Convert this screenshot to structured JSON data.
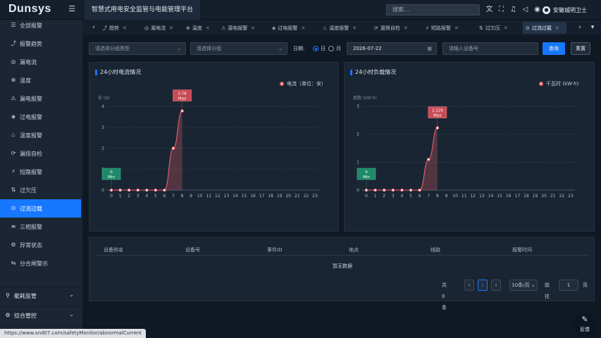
{
  "header": {
    "logo": "Dunsys",
    "app_title": "智慧式用电安全监管与电能管理平台",
    "search_placeholder": "搜索...",
    "user_name": "安徽城明卫士",
    "icons": [
      "translate-icon",
      "fullscreen-icon",
      "bell-icon",
      "volume-icon",
      "globe-icon"
    ]
  },
  "sidebar": {
    "items": [
      {
        "label": "全部报警",
        "icon": "list-icon"
      },
      {
        "label": "报警趋势",
        "icon": "trend-icon"
      },
      {
        "label": "漏电流",
        "icon": "leak-icon"
      },
      {
        "label": "温度",
        "icon": "thermometer-icon"
      },
      {
        "label": "漏电报警",
        "icon": "warning-icon"
      },
      {
        "label": "过电报警",
        "icon": "shield-icon"
      },
      {
        "label": "温度报警",
        "icon": "thermo-alarm-icon"
      },
      {
        "label": "漏保自检",
        "icon": "selfcheck-icon"
      },
      {
        "label": "短路报警",
        "icon": "shortcircuit-icon"
      },
      {
        "label": "过欠压",
        "icon": "voltage-icon"
      },
      {
        "label": "过流过载",
        "icon": "overload-icon"
      },
      {
        "label": "三相报警",
        "icon": "threephase-icon"
      },
      {
        "label": "异常状态",
        "icon": "abnormal-icon"
      },
      {
        "label": "分合闸警示",
        "icon": "switch-icon"
      }
    ],
    "active_index": 10,
    "groups": [
      {
        "label": "能耗监管"
      },
      {
        "label": "综合管控"
      }
    ]
  },
  "status_url": "https://www.snd07.com/safetyMonitor/abnormalCurrent",
  "tabs": [
    {
      "label": "趋势"
    },
    {
      "label": "漏电流"
    },
    {
      "label": "温度"
    },
    {
      "label": "漏电报警"
    },
    {
      "label": "过电报警"
    },
    {
      "label": "温度报警"
    },
    {
      "label": "漏保自检"
    },
    {
      "label": "短路报警"
    },
    {
      "label": "过欠压"
    },
    {
      "label": "过流过载"
    }
  ],
  "active_tab": 9,
  "filter": {
    "type_placeholder": "请选择分组类型",
    "group_placeholder": "请选择分组",
    "date_label": "日期:",
    "radio_day": "日",
    "radio_month": "月",
    "date_value": "2026-07-22",
    "device_placeholder": "请输入设备号",
    "query_label": "查询",
    "reset_label": "重置"
  },
  "colors": {
    "accent": "#1677ff",
    "series": "#e8606a",
    "max_tag": "#c94b55",
    "min_tag": "#1f8a6a"
  },
  "chart_data": [
    {
      "type": "line",
      "title": "24小时电流情况",
      "legend": "电流（单位：安）",
      "ylabel": "安 (A)",
      "x": [
        "0",
        "1",
        "2",
        "3",
        "4",
        "5",
        "6",
        "7",
        "8",
        "9",
        "10",
        "11",
        "12",
        "13",
        "14",
        "15",
        "16",
        "17",
        "18",
        "19",
        "20",
        "21",
        "22",
        "23"
      ],
      "values": [
        0,
        0,
        0,
        0,
        0,
        0,
        0,
        2.0,
        3.78,
        null,
        null,
        null,
        null,
        null,
        null,
        null,
        null,
        null,
        null,
        null,
        null,
        null,
        null,
        null
      ],
      "ylim": [
        0,
        4
      ],
      "yticks": [
        "0",
        "1",
        "2",
        "3",
        "4"
      ],
      "max": {
        "value": "3.78",
        "label": "Max",
        "x_index": 8
      },
      "min": {
        "value": "0",
        "label": "Min",
        "x_index": 0
      },
      "grid": true
    },
    {
      "type": "line",
      "title": "24小时负载情况",
      "legend": "千瓦时 (kW·h)",
      "ylabel": "度数 (kW·h)",
      "x": [
        "0",
        "1",
        "2",
        "3",
        "4",
        "5",
        "6",
        "7",
        "8",
        "9",
        "10",
        "11",
        "12",
        "13",
        "14",
        "15",
        "16",
        "17",
        "18",
        "19",
        "20",
        "21",
        "22",
        "23"
      ],
      "values": [
        0,
        0,
        0,
        0,
        0,
        0,
        0,
        1.1,
        2.229,
        null,
        null,
        null,
        null,
        null,
        null,
        null,
        null,
        null,
        null,
        null,
        null,
        null,
        null,
        null
      ],
      "ylim": [
        0,
        3
      ],
      "yticks": [
        "0",
        "1",
        "2",
        "3"
      ],
      "max": {
        "value": "2.229",
        "label": "Max",
        "x_index": 8
      },
      "min": {
        "value": "0",
        "label": "Min",
        "x_index": 0
      },
      "grid": true
    }
  ],
  "table": {
    "columns": [
      "设备别名",
      "设备号",
      "事件ID",
      "地点",
      "线路",
      "报警时间"
    ],
    "empty_text": "暂无数据"
  },
  "pagination": {
    "total": "共 0 条",
    "current": "1",
    "page_size": "10条/页",
    "goto_label": "前往",
    "goto_value": "1",
    "page_unit": "页"
  },
  "feedback_label": "反馈"
}
